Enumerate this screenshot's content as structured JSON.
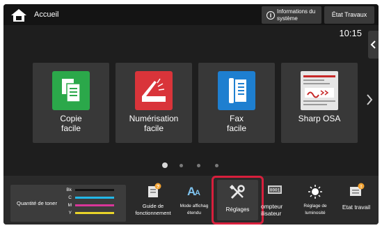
{
  "header": {
    "home_label": "Accueil",
    "info_label_1": "Informations du",
    "info_label_2": "système",
    "jobs_label": "État Travaux",
    "clock": "10:15"
  },
  "tiles": [
    {
      "label_1": "Copie",
      "label_2": "facile",
      "icon": "copy-icon",
      "color": "#2ba84a"
    },
    {
      "label_1": "Numérisation",
      "label_2": "facile",
      "icon": "scan-icon",
      "color": "#d9343a"
    },
    {
      "label_1": "Fax",
      "label_2": "facile",
      "icon": "fax-icon",
      "color": "#1e7fd0"
    },
    {
      "label_1": "Sharp OSA",
      "label_2": "",
      "icon": "sharp-osa-icon",
      "color": "#c62828"
    }
  ],
  "pagination": {
    "pages": 4,
    "current": 1
  },
  "toner": {
    "label": "Quantité de toner",
    "rows": [
      {
        "letter": "Bk",
        "color": "#111111"
      },
      {
        "letter": "C",
        "color": "#22b8e8"
      },
      {
        "letter": "M",
        "color": "#d9369a"
      },
      {
        "letter": "Y",
        "color": "#e8d32a"
      }
    ]
  },
  "dock": {
    "guide_1": "Guide de",
    "guide_2": "fonctionnement",
    "display_1": "Mode affichag",
    "display_2": "étendu",
    "settings": "Réglages",
    "counter_1": "ompteur",
    "counter_2": "ilisateur",
    "brightness_1": "Réglage de",
    "brightness_2": "luminosité",
    "job_status": "Etat travail"
  }
}
